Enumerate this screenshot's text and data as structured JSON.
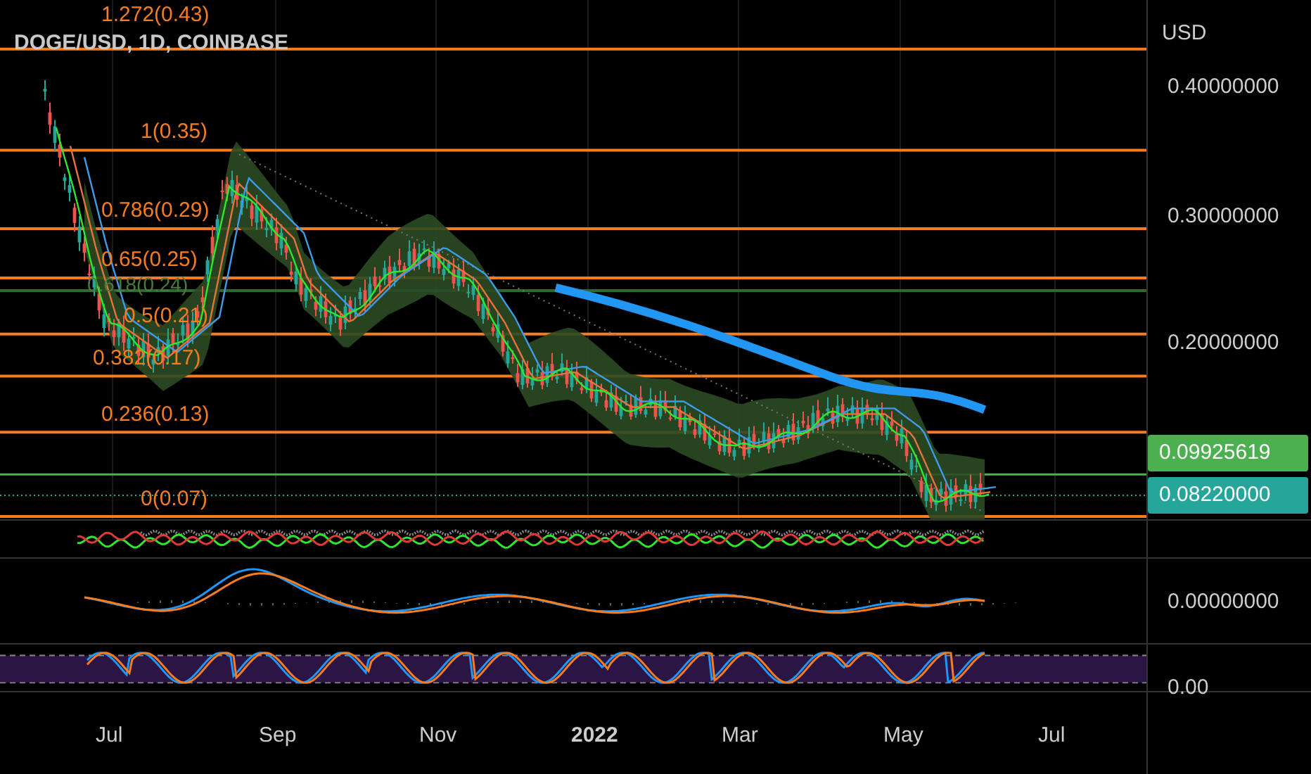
{
  "symbol": "DOGE/USD, 1D, COINBASE",
  "currency": "USD",
  "fib_levels": [
    {
      "label": "1.272(0.43)"
    },
    {
      "label": "1(0.35)"
    },
    {
      "label": "0.786(0.29)"
    },
    {
      "label": "0.65(0.25)"
    },
    {
      "label": "0.618(0.24)"
    },
    {
      "label": "0.5(0.21)"
    },
    {
      "label": "0.382(0.17)"
    },
    {
      "label": "0.236(0.13)"
    },
    {
      "label": "0(0.07)"
    }
  ],
  "price_scale": [
    "0.40000000",
    "0.30000000",
    "0.20000000"
  ],
  "price_badges": [
    {
      "text": "0.09925619",
      "color": "#4caf50"
    },
    {
      "text": "0.08220000",
      "color": "#26a69a"
    }
  ],
  "oscillator_scale": [
    "0.00000000",
    "0.00"
  ],
  "time_axis": [
    {
      "label": "Jul",
      "kind": "month"
    },
    {
      "label": "Sep",
      "kind": "month"
    },
    {
      "label": "Nov",
      "kind": "month"
    },
    {
      "label": "2022",
      "kind": "year"
    },
    {
      "label": "Mar",
      "kind": "month"
    },
    {
      "label": "May",
      "kind": "month"
    },
    {
      "label": "Jul",
      "kind": "month"
    }
  ]
}
